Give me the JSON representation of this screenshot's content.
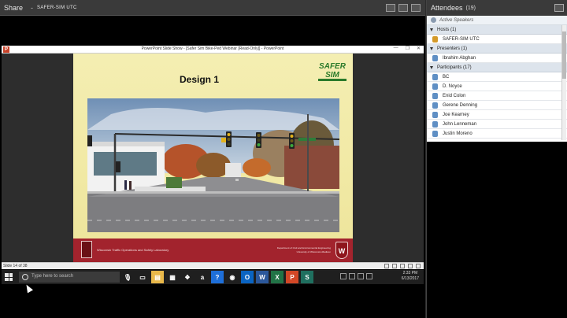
{
  "share": {
    "title": "Share",
    "separator": "-",
    "owner": "SAFER-SIM UTC"
  },
  "powerpoint": {
    "window_title": "PowerPoint Slide Show - [Safer Sim Bike-Ped Webinar [Read-Only]] - PowerPoint",
    "app_icon_letter": "P",
    "status": "Slide 14 of 38",
    "controls": [
      "—",
      "❐",
      "✕"
    ]
  },
  "slide": {
    "title": "Design 1",
    "logo_text": "SAFER SIM",
    "footer_left": "Wisconsin Traffic Operations and Safety Laboratory",
    "footer_right_1": "Department of Civil and Environmental Engineering",
    "footer_right_2": "University of Wisconsin-Madison",
    "crest_letter": "W"
  },
  "taskbar": {
    "search_placeholder": "Type here to search",
    "apps": [
      {
        "icon": "mic-icon",
        "label": "🎙",
        "color": "#1f1f1f"
      },
      {
        "icon": "task-view-icon",
        "label": "▭",
        "color": "#1f1f1f"
      },
      {
        "icon": "file-explorer-icon",
        "label": "▤",
        "color": "#e8b84a"
      },
      {
        "icon": "store-icon",
        "label": "▦",
        "color": "#1f1f1f"
      },
      {
        "icon": "dropbox-icon",
        "label": "❖",
        "color": "#1f1f1f"
      },
      {
        "icon": "amazon-icon",
        "label": "a",
        "color": "#1f1f1f"
      },
      {
        "icon": "help-icon",
        "label": "?",
        "color": "#1e6fd9"
      },
      {
        "icon": "chrome-icon",
        "label": "◉",
        "color": "#1f1f1f"
      },
      {
        "icon": "outlook-icon",
        "label": "O",
        "color": "#0a64c2"
      },
      {
        "icon": "word-icon",
        "label": "W",
        "color": "#2b579a"
      },
      {
        "icon": "excel-icon",
        "label": "X",
        "color": "#217346"
      },
      {
        "icon": "powerpoint-icon",
        "label": "P",
        "color": "#d24726"
      },
      {
        "icon": "shell-icon",
        "label": "S",
        "color": "#1f6f5f"
      }
    ],
    "time": "2:33 PM",
    "date": "6/13/2017"
  },
  "attendees": {
    "title": "Attendees",
    "count": "(19)",
    "active_speakers": "Active Speakers",
    "groups": [
      {
        "label": "Hosts (1)",
        "people": [
          {
            "name": "SAFER-SIM UTC",
            "role": "host"
          }
        ]
      },
      {
        "label": "Presenters (1)",
        "people": [
          {
            "name": "Ibrahim Abghan",
            "role": "presenter"
          }
        ]
      },
      {
        "label": "Participants (17)",
        "people": [
          {
            "name": "BC",
            "role": "participant"
          },
          {
            "name": "D. Noyce",
            "role": "participant"
          },
          {
            "name": "Enid Colon",
            "role": "participant"
          },
          {
            "name": "Gerene Denning",
            "role": "participant"
          },
          {
            "name": "Joe Kearney",
            "role": "participant"
          },
          {
            "name": "John Lenneman",
            "role": "participant"
          },
          {
            "name": "Justin Moreno",
            "role": "participant"
          }
        ]
      }
    ]
  }
}
